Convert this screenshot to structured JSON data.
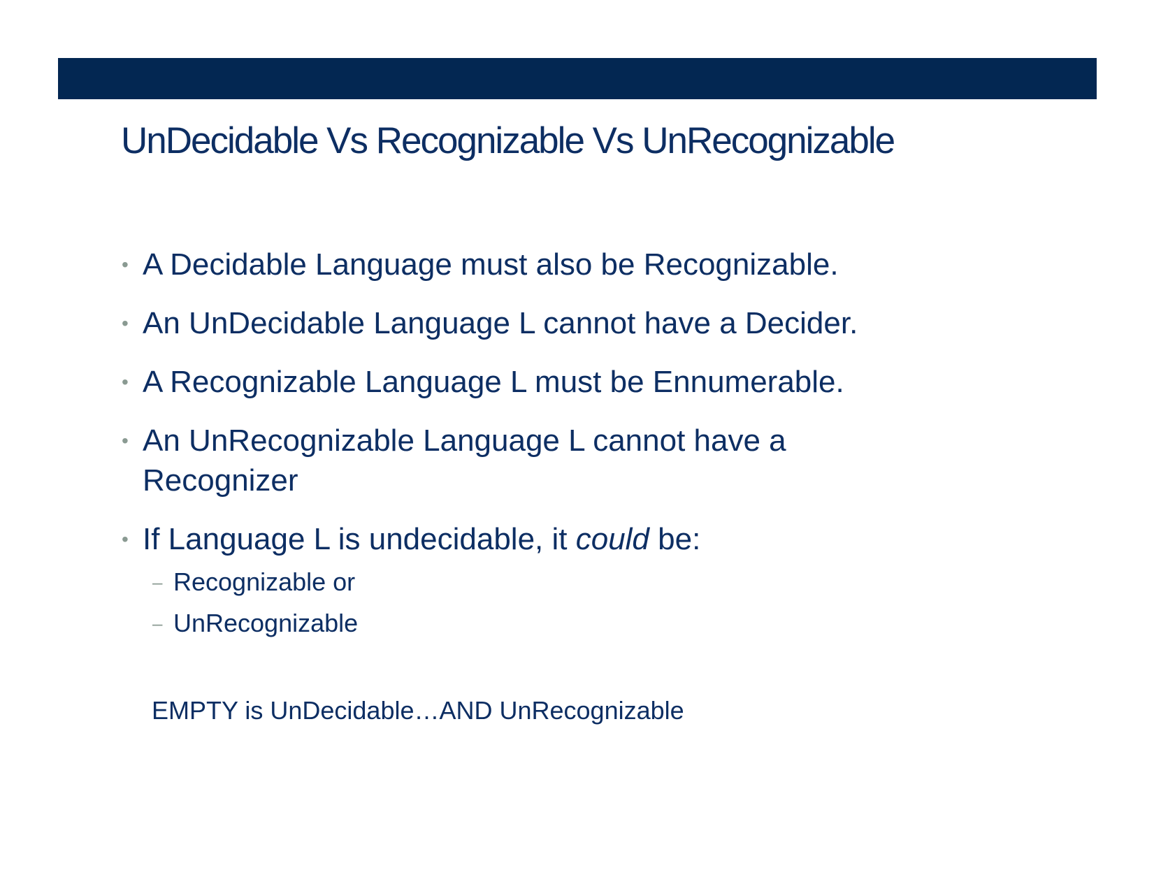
{
  "slide": {
    "title": "UnDecidable Vs Recognizable Vs UnRecognizable",
    "bullet_marker": "•",
    "sub_marker": "–",
    "bullets": [
      {
        "text": "A Decidable Language must also be Recognizable."
      },
      {
        "text": "An UnDecidable Language L cannot have a Decider."
      },
      {
        "text": "A Recognizable Language L must be Ennumerable."
      },
      {
        "text_line1": "An UnRecognizable Language L cannot have a",
        "text_line2": "Recognizer"
      },
      {
        "before": "If Language L is undecidable, it ",
        "emphasis": "could",
        "after": " be:"
      }
    ],
    "sub_items": [
      "Recognizable or",
      "UnRecognizable"
    ],
    "note": "EMPTY is UnDecidable…AND UnRecognizable"
  },
  "colors": {
    "header_bar": "#032752",
    "text": "#0d2e63",
    "bullet_marker": "#8a9a92"
  }
}
